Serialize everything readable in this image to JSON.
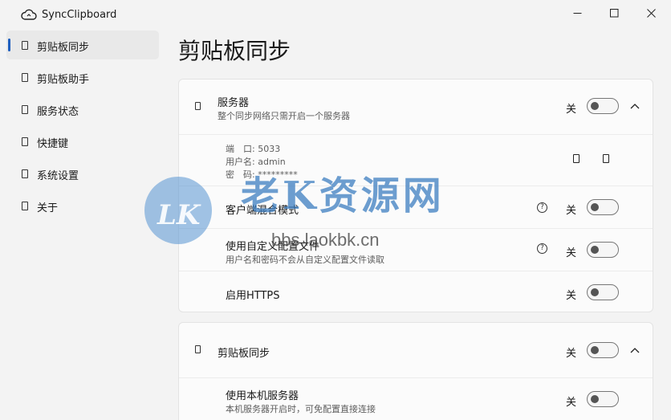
{
  "window": {
    "title": "SyncClipboard",
    "icons": {
      "app": "cloud-sync-icon",
      "minimize": "minimize-icon",
      "maximize": "maximize-icon",
      "close": "close-icon"
    }
  },
  "sidebar": {
    "items": [
      {
        "label": "剪贴板同步",
        "active": true
      },
      {
        "label": "剪贴板助手"
      },
      {
        "label": "服务状态"
      },
      {
        "label": "快捷键"
      },
      {
        "label": "系统设置"
      },
      {
        "label": "关于"
      }
    ]
  },
  "page": {
    "title": "剪贴板同步"
  },
  "server_card": {
    "title": "服务器",
    "subtitle": "整个同步网络只需开启一个服务器",
    "toggle_text": "关",
    "info": {
      "port_label": "端　口:",
      "port_value": "5033",
      "user_label": "用户名:",
      "user_value": "admin",
      "pass_label": "密　码:",
      "pass_value": "*********"
    },
    "options": [
      {
        "title": "客户端混合模式",
        "toggle_text": "关",
        "help": "?"
      },
      {
        "title": "使用自定义配置文件",
        "desc": "用户名和密码不会从自定义配置文件读取",
        "toggle_text": "关",
        "help": "?"
      },
      {
        "title": "启用HTTPS",
        "toggle_text": "关"
      }
    ]
  },
  "sync_card": {
    "title": "剪贴板同步",
    "toggle_text": "关",
    "options": [
      {
        "title": "使用本机服务器",
        "desc": "本机服务器开启时，可免配置直接连接",
        "toggle_text": "关"
      }
    ]
  },
  "watermark": {
    "logo_text": "LK",
    "site_name": "老K资源网",
    "url": "bbs.laokbk.cn"
  },
  "colors": {
    "accent": "#1f5fbf",
    "background": "#f3f3f3",
    "card": "#fbfbfb"
  }
}
